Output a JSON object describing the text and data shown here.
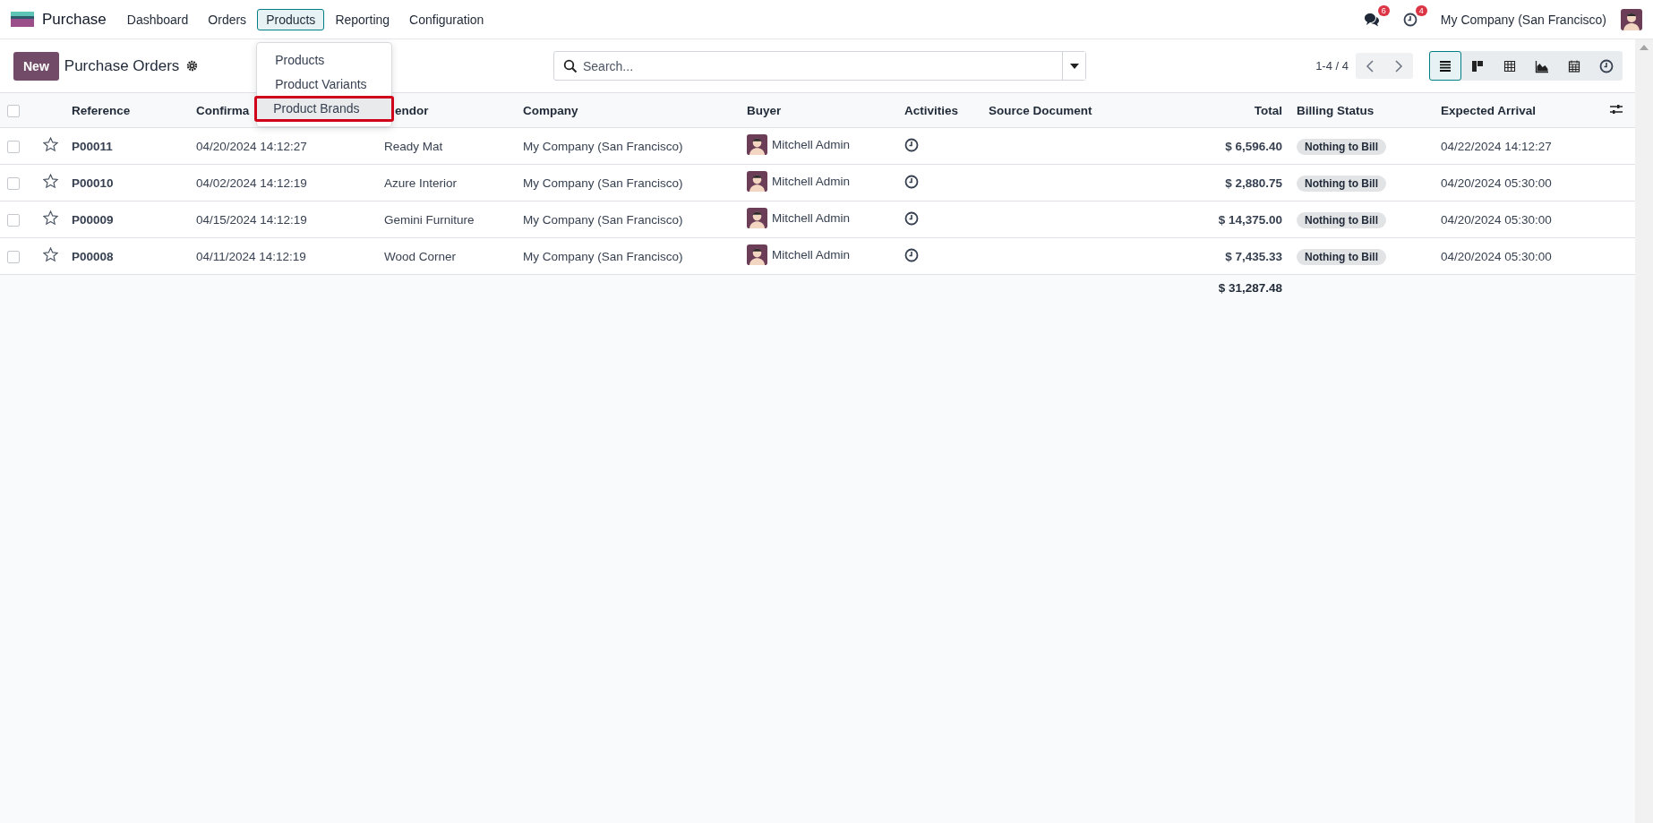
{
  "app": {
    "name": "Purchase"
  },
  "menu": [
    {
      "label": "Dashboard",
      "selected": false
    },
    {
      "label": "Orders",
      "selected": false
    },
    {
      "label": "Products",
      "selected": true,
      "dropdown": [
        {
          "label": "Products",
          "selected": false
        },
        {
          "label": "Product Variants",
          "selected": false
        },
        {
          "label": "Product Brands",
          "selected": true
        }
      ]
    },
    {
      "label": "Reporting",
      "selected": false
    },
    {
      "label": "Configuration",
      "selected": false
    }
  ],
  "systray": {
    "messages_count": "6",
    "activities_count": "4",
    "company": "My Company (San Francisco)"
  },
  "control_panel": {
    "new_button": "New",
    "title": "Purchase Orders",
    "search": {
      "placeholder": "Search..."
    },
    "pager": "1-4 / 4",
    "views": [
      {
        "kind": "list",
        "selected": true
      },
      {
        "kind": "kanban",
        "selected": false
      },
      {
        "kind": "pivot",
        "selected": false
      },
      {
        "kind": "graph",
        "selected": false
      },
      {
        "kind": "calendar",
        "selected": false
      },
      {
        "kind": "activity",
        "selected": false
      }
    ]
  },
  "table": {
    "select_all": {
      "checked": false
    },
    "columns": [
      "Reference",
      "Confirma",
      "endor",
      "Company",
      "Buyer",
      "Activities",
      "Source Document",
      "Total",
      "Billing Status",
      "Expected Arrival"
    ],
    "rows": [
      {
        "checked": false,
        "starred": false,
        "reference": "P00011",
        "confirmation": "04/20/2024 14:12:27",
        "vendor": "Ready Mat",
        "company": "My Company (San Francisco)",
        "buyer": "Mitchell Admin",
        "total": "$ 6,596.40",
        "billing_status": "Nothing to Bill",
        "expected_arrival": "04/22/2024 14:12:27"
      },
      {
        "checked": false,
        "starred": false,
        "reference": "P00010",
        "confirmation": "04/02/2024 14:12:19",
        "vendor": "Azure Interior",
        "company": "My Company (San Francisco)",
        "buyer": "Mitchell Admin",
        "total": "$ 2,880.75",
        "billing_status": "Nothing to Bill",
        "expected_arrival": "04/20/2024 05:30:00"
      },
      {
        "checked": false,
        "starred": false,
        "reference": "P00009",
        "confirmation": "04/15/2024 14:12:19",
        "vendor": "Gemini Furniture",
        "company": "My Company (San Francisco)",
        "buyer": "Mitchell Admin",
        "total": "$ 14,375.00",
        "billing_status": "Nothing to Bill",
        "expected_arrival": "04/20/2024 05:30:00"
      },
      {
        "checked": false,
        "starred": false,
        "reference": "P00008",
        "confirmation": "04/11/2024 14:12:19",
        "vendor": "Wood Corner",
        "company": "My Company (San Francisco)",
        "buyer": "Mitchell Admin",
        "total": "$ 7,435.33",
        "billing_status": "Nothing to Bill",
        "expected_arrival": "04/20/2024 05:30:00"
      }
    ],
    "grand_total": "$ 31,287.48"
  }
}
